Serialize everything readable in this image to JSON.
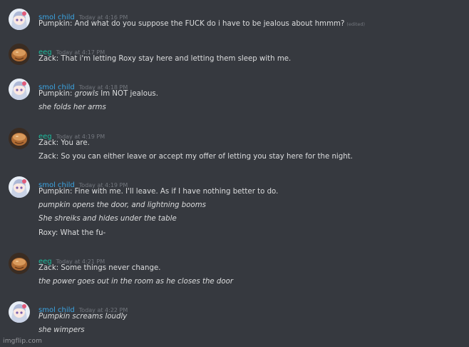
{
  "colors": {
    "background": "#36393f",
    "text": "#dcddde",
    "timestamp": "#72767d",
    "smol_child_name": "#3ba5e3",
    "eeg_name": "#1abc9c"
  },
  "messages": [
    {
      "author": "smol child",
      "avatar": "anime-girl-avatar",
      "timestamp": "Today at 4:16 PM",
      "lines": [
        {
          "text": "Pumpkin: And what do you suppose the FUCK do i have to be jealous about hmmm?",
          "edited": "(edited)"
        }
      ]
    },
    {
      "author": "eeg",
      "avatar": "bread-avatar",
      "timestamp": "Today at 4:17 PM",
      "lines": [
        {
          "text": "Zack: That i'm letting Roxy stay here and letting them sleep with me."
        }
      ]
    },
    {
      "author": "smol child",
      "avatar": "anime-girl-avatar",
      "timestamp": "Today at 4:18 PM",
      "lines": [
        {
          "prefix": "Pumpkin: ",
          "italic": "growls",
          "suffix": " Im NOT jealous."
        },
        {
          "text": "she folds her arms",
          "style": "italic"
        }
      ]
    },
    {
      "author": "eeg",
      "avatar": "bread-avatar",
      "timestamp": "Today at 4:19 PM",
      "lines": [
        {
          "text": "Zack: You are."
        },
        {
          "text": "Zack: So you can either leave or accept my offer of letting you stay here for the night."
        }
      ]
    },
    {
      "author": "smol child",
      "avatar": "anime-girl-avatar",
      "timestamp": "Today at 4:19 PM",
      "lines": [
        {
          "text": "Pumpkin: Fine with me. I'll leave. As if I have nothing better to do."
        },
        {
          "text": "pumpkin opens the door, and lightning booms",
          "style": "italic"
        },
        {
          "text": "She shreiks and hides under the table",
          "style": "italic"
        },
        {
          "text": "Roxy: What the fu-"
        }
      ]
    },
    {
      "author": "eeg",
      "avatar": "bread-avatar",
      "timestamp": "Today at 4:21 PM",
      "lines": [
        {
          "text": "Zack: Some things never change."
        },
        {
          "text": "the power goes out in the room as he closes the door",
          "style": "italic"
        }
      ]
    },
    {
      "author": "smol child",
      "avatar": "anime-girl-avatar",
      "timestamp": "Today at 4:22 PM",
      "lines": [
        {
          "text": "Pumpkin screams loudly",
          "style": "italic"
        },
        {
          "text": "she wimpers",
          "style": "italic"
        }
      ]
    }
  ],
  "watermark": "imgflip.com"
}
